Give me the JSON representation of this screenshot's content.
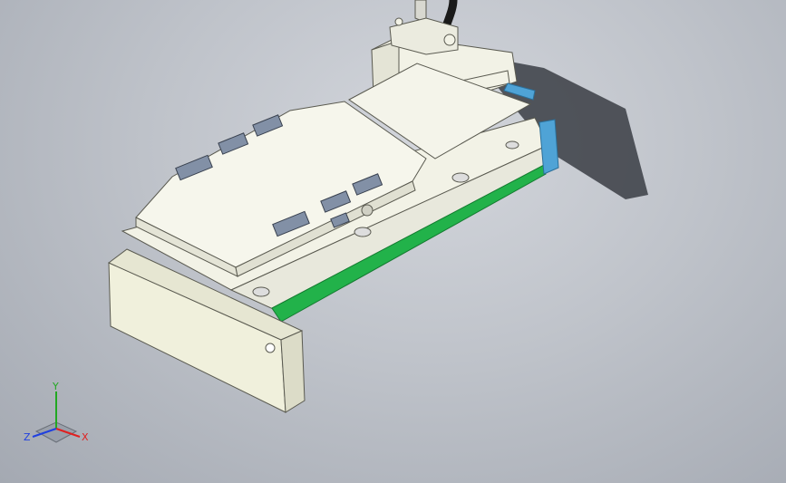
{
  "viewport": {
    "background_top": "#d3d6dc",
    "background_bottom": "#a4a9b2"
  },
  "model": {
    "body_color": "#f2f2e6",
    "shadow_color": "#3a3d44",
    "rail_color": "#22b24a",
    "end_plate_color": "#4fa3d6",
    "edge_color": "#5a5a50"
  },
  "triad": {
    "x_label": "X",
    "y_label": "Y",
    "z_label": "Z",
    "x_color": "#e02020",
    "y_color": "#22a822",
    "z_color": "#2040e0"
  }
}
